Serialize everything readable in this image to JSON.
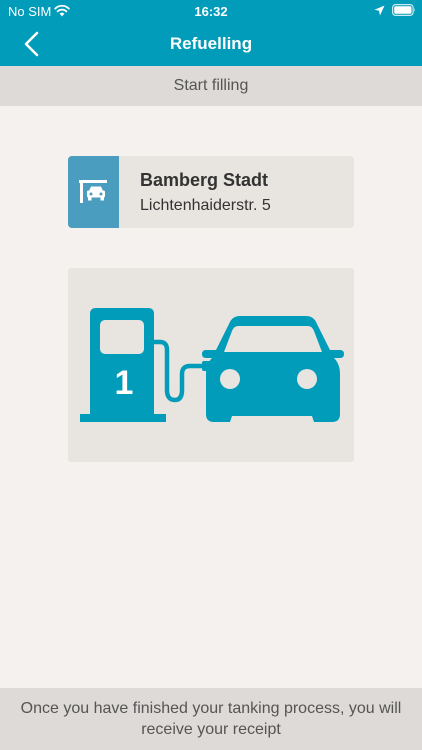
{
  "status_bar": {
    "carrier": "No SIM",
    "time": "16:32",
    "wifi_icon": "wifi-icon",
    "location_icon": "location-arrow-icon",
    "battery_icon": "battery-icon"
  },
  "nav": {
    "title": "Refuelling",
    "back_icon": "chevron-left-icon"
  },
  "subheader": {
    "label": "Start filling"
  },
  "station": {
    "icon": "gas-station-car-icon",
    "name": "Bamberg Stadt",
    "address": "Lichtenhaiderstr. 5"
  },
  "pump": {
    "icon": "fuel-pump-car-illustration",
    "number": "1"
  },
  "footer": {
    "message": "Once you have finished your tanking process, you will receive your receipt"
  },
  "colors": {
    "header": "#009cb9",
    "accent": "#009cb9",
    "station_icon_bg": "#4a9dbf",
    "background": "#f5f1ee",
    "panel": "#e8e4e0",
    "bar": "#dedad7"
  }
}
